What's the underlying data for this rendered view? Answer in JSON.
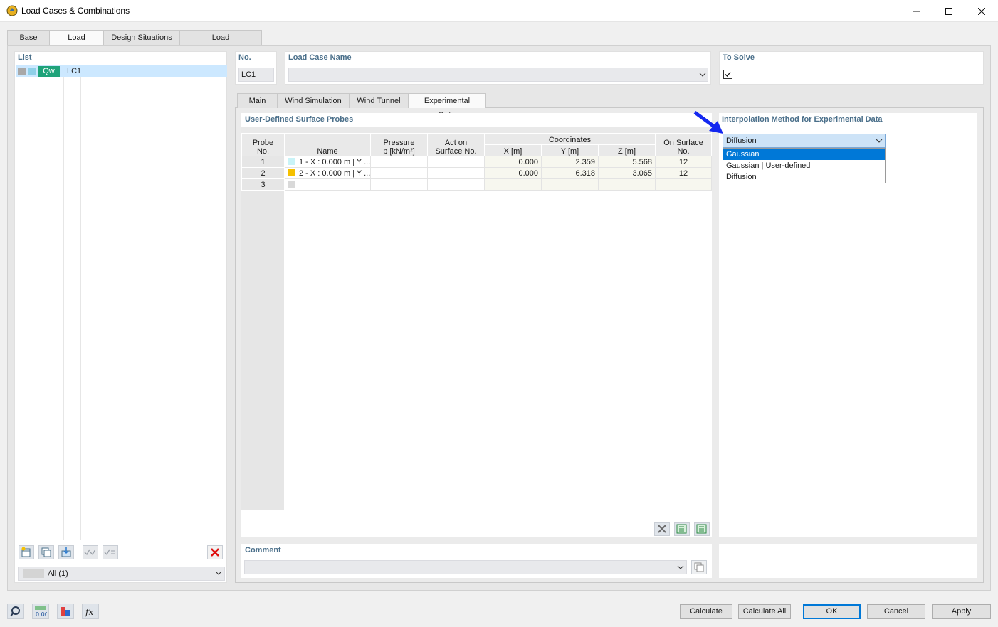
{
  "window": {
    "title": "Load Cases & Combinations"
  },
  "tabs": [
    "Base",
    "Load Cases",
    "Design Situations",
    "Load Combinations"
  ],
  "active_tab": "Load Cases",
  "list": {
    "label": "List",
    "items": [
      {
        "tag": "Qw",
        "name": "LC1"
      }
    ],
    "filter_value": "All (1)"
  },
  "header": {
    "no_label": "No.",
    "no_value": "LC1",
    "name_label": "Load Case Name",
    "name_value": "",
    "to_solve_label": "To Solve",
    "to_solve_checked": true
  },
  "subtabs": [
    "Main",
    "Wind Simulation",
    "Wind Tunnel",
    "Experimental Data"
  ],
  "active_subtab": "Experimental Data",
  "probes": {
    "label": "User-Defined Surface Probes",
    "columns": {
      "probe_no": "Probe\nNo.",
      "probe_no_1": "Probe",
      "probe_no_2": "No.",
      "name": "Name",
      "pressure_1": "Pressure",
      "pressure_2": "p [kN/m²]",
      "act_on_1": "Act on",
      "act_on_2": "Surface No.",
      "coordinates": "Coordinates",
      "x": "X [m]",
      "y": "Y [m]",
      "z": "Z [m]",
      "on_surface_1": "On Surface",
      "on_surface_2": "No."
    },
    "rows": [
      {
        "no": "1",
        "color": "#c9f3f7",
        "name": "1 - X : 0.000 m | Y ...",
        "pressure": "",
        "act_on": "",
        "x": "0.000",
        "y": "2.359",
        "z": "5.568",
        "surface": "12"
      },
      {
        "no": "2",
        "color": "#f5c000",
        "name": "2 - X : 0.000 m | Y ...",
        "pressure": "",
        "act_on": "",
        "x": "0.000",
        "y": "6.318",
        "z": "3.065",
        "surface": "12"
      },
      {
        "no": "3",
        "color": "#d9d9d9",
        "name": "",
        "pressure": "",
        "act_on": "",
        "x": "",
        "y": "",
        "z": "",
        "surface": ""
      }
    ]
  },
  "interpolation": {
    "label": "Interpolation Method for Experimental Data",
    "selected": "Diffusion",
    "options": [
      "Gaussian",
      "Gaussian | User-defined",
      "Diffusion"
    ],
    "highlighted": "Gaussian"
  },
  "comment": {
    "label": "Comment",
    "value": ""
  },
  "buttons": {
    "calculate": "Calculate",
    "calculate_all": "Calculate All",
    "ok": "OK",
    "cancel": "Cancel",
    "apply": "Apply"
  },
  "colors": {
    "accent": "#0078d7",
    "tag_green": "#1fa37a",
    "arrow_blue": "#1428f0",
    "label_blue": "#4a6f8a"
  }
}
